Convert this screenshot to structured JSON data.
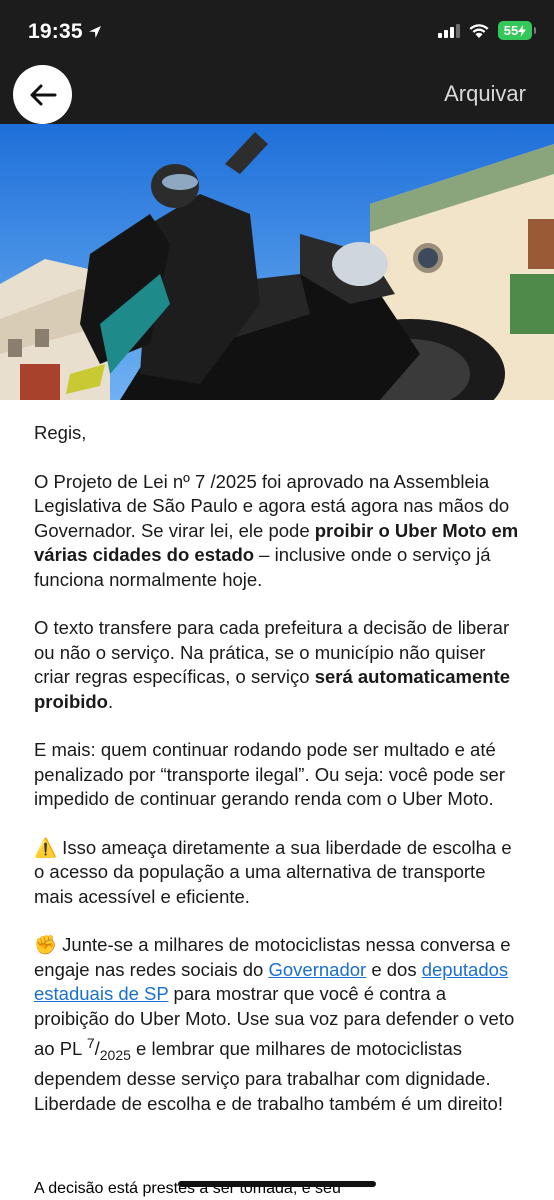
{
  "status_bar": {
    "time": "19:35",
    "battery": "55"
  },
  "header": {
    "archive_label": "Arquivar"
  },
  "email": {
    "greeting": "Regis,",
    "p1": {
      "text_a": "O Projeto de Lei nº 7 /2025 foi aprovado na Assembleia Legislativa de São Paulo e agora está agora nas mãos do Governador. Se virar lei, ele pode ",
      "bold": "proibir o Uber Moto em várias cidades do estado",
      "text_b": " – inclusive onde o serviço já funciona normalmente hoje."
    },
    "p2": {
      "text_a": "O texto transfere para cada prefeitura a decisão de liberar ou não o serviço. Na prática, se o município não quiser criar regras específicas, o serviço ",
      "bold": "será automaticamente proibido",
      "text_b": "."
    },
    "p3": "E mais: quem continuar rodando pode ser multado e até penalizado por “transporte ilegal”. Ou seja: você pode ser impedido de continuar gerando renda com o Uber Moto.",
    "p4": {
      "emoji": "⚠️",
      "text": " Isso ameaça diretamente a sua liberdade de escolha e o acesso da população a uma alternativa de transporte mais acessível e eficiente."
    },
    "p5": {
      "emoji": "✊",
      "text_a": " Junte-se a milhares de motociclistas nessa conversa e engaje nas redes sociais do ",
      "link_governor": "Governador",
      "text_b": " e dos ",
      "link_deputies": "deputados estaduais de SP",
      "text_c": " para mostrar que você é contra a proibição do Uber Moto. Use sua voz para defender o veto ao PL ",
      "pl_num": "7",
      "pl_slash": "/",
      "pl_year": "2025",
      "text_d": " e lembrar que milhares de motociclistas dependem desse serviço para trabalhar com dignidade. Liberdade de escolha e de trabalho também é um direito!"
    },
    "p6_cut": "A decisão está prestes a ser tomada, e seu"
  },
  "colors": {
    "header_bg": "#1c1c1c",
    "link": "#1a6fd1",
    "battery": "#34c759"
  }
}
